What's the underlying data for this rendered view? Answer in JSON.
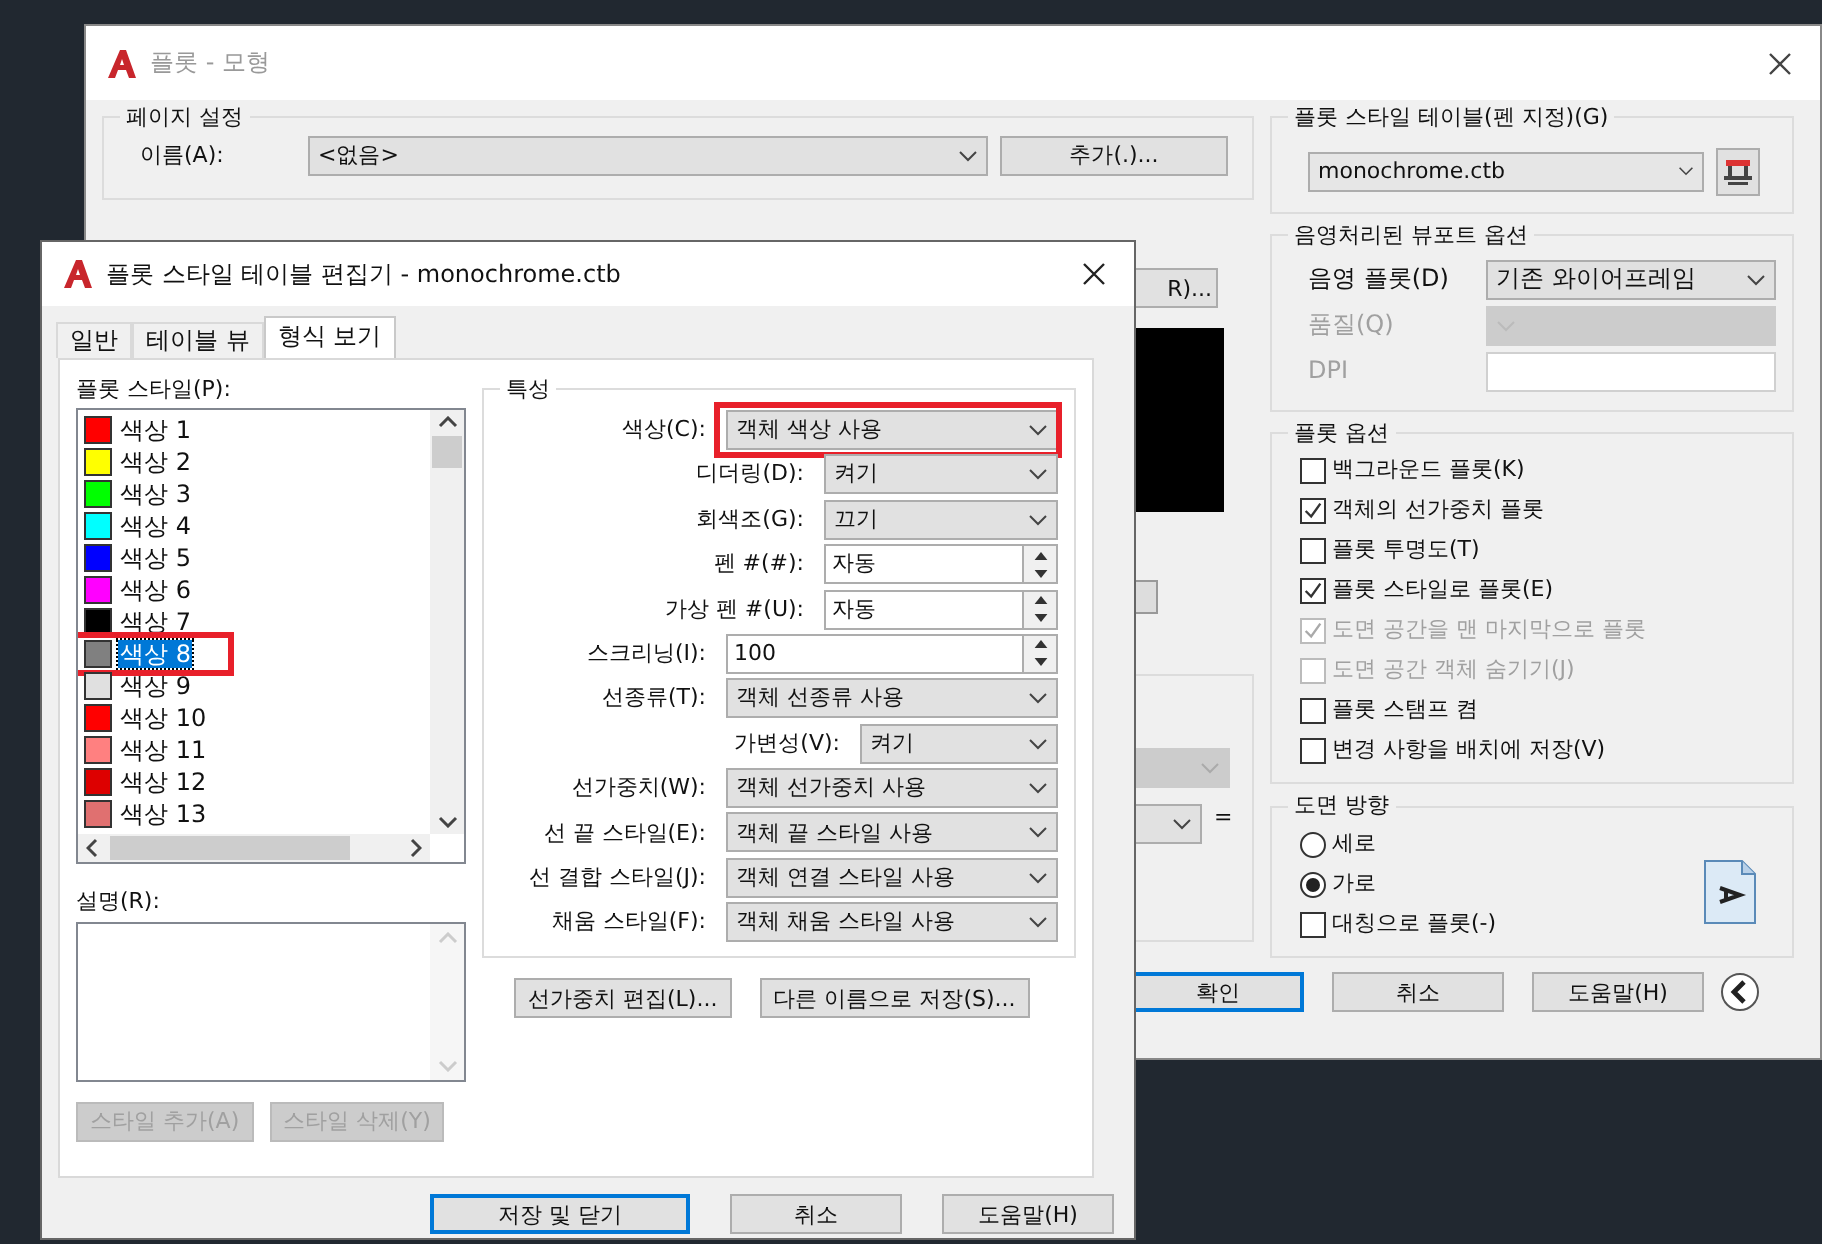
{
  "plot_dialog": {
    "title": "플롯 - 모형",
    "page_setup": {
      "title": "페이지 설정",
      "name_label": "이름(A):",
      "name_value": "<없음>",
      "add_button": "추가(.)..."
    },
    "printer_fragment": {
      "button": "R)...",
      "equals_sign": "="
    },
    "plot_style_table": {
      "title": "플롯 스타일 테이블(펜 지정)(G)",
      "value": "monochrome.ctb"
    },
    "shaded_viewport": {
      "title": "음영처리된 뷰포트 옵션",
      "rows": [
        {
          "label": "음영 플롯(D)",
          "value": "기존 와이어프레임",
          "disabled": false,
          "kind": "dropdown"
        },
        {
          "label": "품질(Q)",
          "disabled": true,
          "kind": "dropdown"
        },
        {
          "label": "DPI",
          "disabled": true,
          "kind": "field"
        }
      ]
    },
    "plot_options": {
      "title": "플롯 옵션",
      "items": [
        {
          "label": "백그라운드 플롯(K)",
          "checked": false,
          "disabled": false
        },
        {
          "label": "객체의 선가중치 플롯",
          "checked": true,
          "disabled": false
        },
        {
          "label": "플롯 투명도(T)",
          "checked": false,
          "disabled": false
        },
        {
          "label": "플롯 스타일로 플롯(E)",
          "checked": true,
          "disabled": false
        },
        {
          "label": "도면 공간을 맨 마지막으로 플롯",
          "checked": true,
          "disabled": true
        },
        {
          "label": "도면 공간 객체 숨기기(J)",
          "checked": false,
          "disabled": true
        },
        {
          "label": "플롯 스탬프 켬",
          "checked": false,
          "disabled": false
        },
        {
          "label": "변경 사항을 배치에 저장(V)",
          "checked": false,
          "disabled": false
        }
      ]
    },
    "orientation": {
      "title": "도면 방향",
      "radios": [
        {
          "label": "세로",
          "selected": false
        },
        {
          "label": "가로",
          "selected": true
        }
      ],
      "mirror": {
        "label": "대칭으로 플롯(-)",
        "checked": false
      }
    },
    "buttons": [
      {
        "label": "확인",
        "default": true
      },
      {
        "label": "취소",
        "default": false
      },
      {
        "label": "도움말(H)",
        "default": false
      }
    ]
  },
  "editor": {
    "title": "플롯 스타일 테이블 편집기 - monochrome.ctb",
    "tabs": [
      {
        "label": "일반",
        "selected": false
      },
      {
        "label": "테이블 뷰",
        "selected": false
      },
      {
        "label": "형식 보기",
        "selected": true
      }
    ],
    "styles_label": "플롯 스타일(P):",
    "styles": [
      {
        "name": "색상 1",
        "color": "#ff0000",
        "selected": false,
        "highlighted": false
      },
      {
        "name": "색상 2",
        "color": "#ffff00",
        "selected": false,
        "highlighted": false
      },
      {
        "name": "색상 3",
        "color": "#00ff00",
        "selected": false,
        "highlighted": false
      },
      {
        "name": "색상 4",
        "color": "#00ffff",
        "selected": false,
        "highlighted": false
      },
      {
        "name": "색상 5",
        "color": "#0000ff",
        "selected": false,
        "highlighted": false
      },
      {
        "name": "색상 6",
        "color": "#ff00ff",
        "selected": false,
        "highlighted": false
      },
      {
        "name": "색상 7",
        "color": "#000000",
        "selected": false,
        "highlighted": false
      },
      {
        "name": "색상 8",
        "color": "#808080",
        "selected": true,
        "highlighted": true
      },
      {
        "name": "색상 9",
        "color": "#e0e0e0",
        "selected": false,
        "highlighted": false
      },
      {
        "name": "색상 10",
        "color": "#ff0000",
        "selected": false,
        "highlighted": false
      },
      {
        "name": "색상 11",
        "color": "#ff8080",
        "selected": false,
        "highlighted": false
      },
      {
        "name": "색상 12",
        "color": "#dd0000",
        "selected": false,
        "highlighted": false
      },
      {
        "name": "색상 13",
        "color": "#e07070",
        "selected": false,
        "highlighted": false
      }
    ],
    "description_label": "설명(R):",
    "style_buttons": [
      {
        "label": "스타일 추가(A)",
        "disabled": true
      },
      {
        "label": "스타일 삭제(Y)",
        "disabled": true
      }
    ],
    "properties": {
      "title": "특성",
      "rows": [
        {
          "label": "색상(C):",
          "value": "객체 색상 사용",
          "kind": "dropdown",
          "highlighted": true
        },
        {
          "label": "디더링(D):",
          "value": "켜기",
          "kind": "dropdown-short",
          "highlighted": false
        },
        {
          "label": "회색조(G):",
          "value": "끄기",
          "kind": "dropdown-short",
          "highlighted": false
        },
        {
          "label": "펜 #(#):",
          "value": "자동",
          "kind": "spinner-short",
          "highlighted": false
        },
        {
          "label": "가상 펜 #(U):",
          "value": "자동",
          "kind": "spinner-short",
          "highlighted": false
        },
        {
          "label": "스크리닝(I):",
          "value": "100",
          "kind": "spinner",
          "highlighted": false
        },
        {
          "label": "선종류(T):",
          "value": "객체 선종류 사용",
          "kind": "dropdown",
          "highlighted": false
        },
        {
          "label": "가변성(V):",
          "value": "켜기",
          "kind": "dropdown-narrow",
          "highlighted": false
        },
        {
          "label": "선가중치(W):",
          "value": "객체 선가중치 사용",
          "kind": "dropdown",
          "highlighted": false
        },
        {
          "label": "선 끝 스타일(E):",
          "value": "객체 끝 스타일 사용",
          "kind": "dropdown",
          "highlighted": false
        },
        {
          "label": "선 결합 스타일(J):",
          "value": "객체 연결 스타일 사용",
          "kind": "dropdown",
          "highlighted": false
        },
        {
          "label": "채움 스타일(F):",
          "value": "객체 채움 스타일 사용",
          "kind": "dropdown",
          "highlighted": false
        }
      ]
    },
    "edit_buttons": [
      "선가중치 편집(L)...",
      "다른 이름으로 저장(S)..."
    ],
    "buttons": [
      {
        "label": "저장 및 닫기",
        "default": true
      },
      {
        "label": "취소",
        "default": false
      },
      {
        "label": "도움말(H)",
        "default": false
      }
    ]
  }
}
